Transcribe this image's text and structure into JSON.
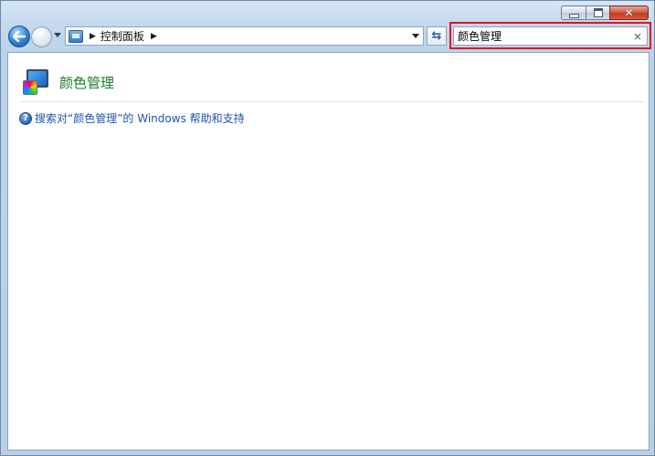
{
  "window": {
    "caption_minimize": "—",
    "caption_maximize": "□",
    "caption_close": "✕"
  },
  "nav": {
    "breadcrumb": [
      "控制面板"
    ],
    "refresh_glyph": "⇆"
  },
  "search": {
    "value": "颜色管理",
    "clear_glyph": "×"
  },
  "results": {
    "items": [
      {
        "title": "颜色管理",
        "icon": "color-management-icon"
      }
    ],
    "help_link": "搜索对“颜色管理”的 Windows 帮助和支持"
  },
  "colors": {
    "highlight_border": "#e0141e",
    "result_title": "#1a7a2a",
    "link": "#1a55b0"
  }
}
